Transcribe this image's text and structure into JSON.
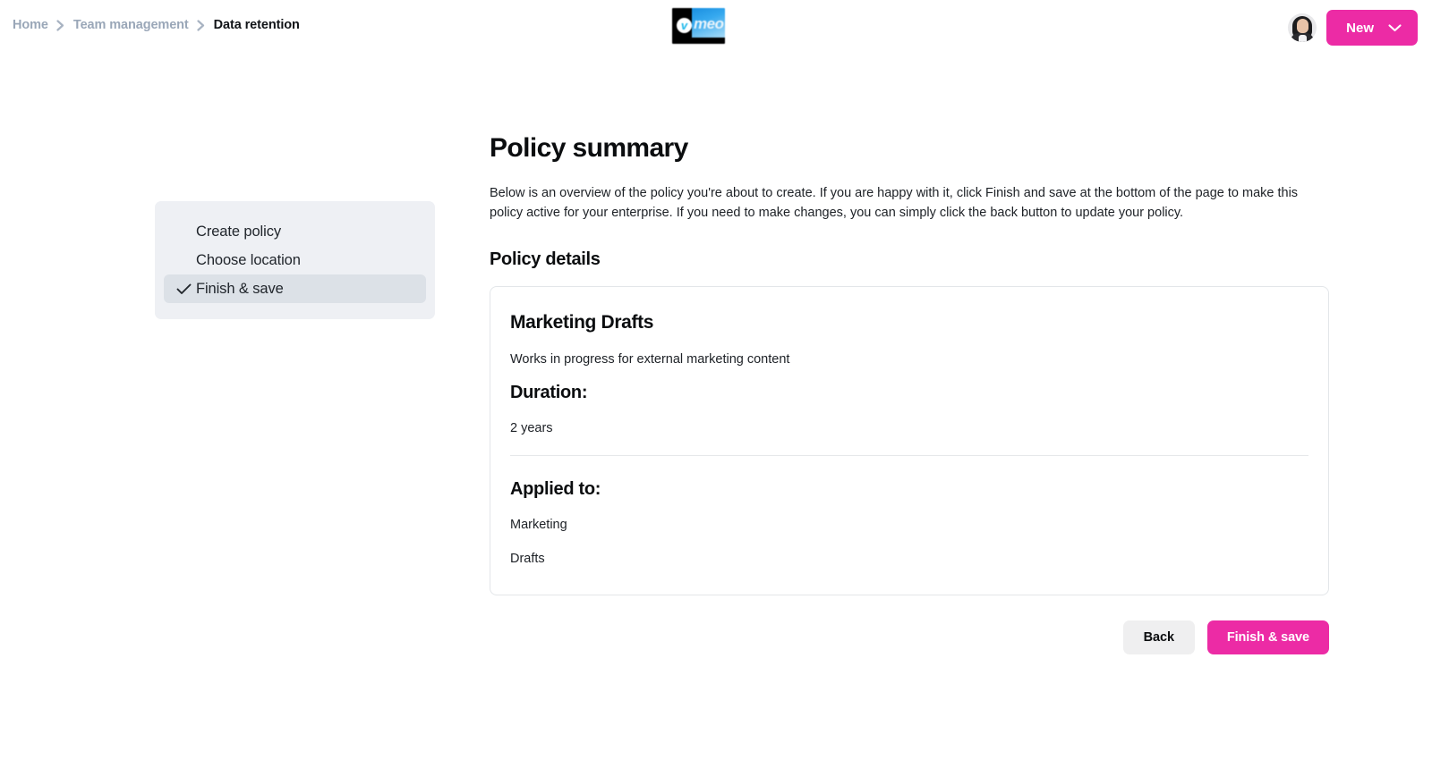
{
  "breadcrumb": {
    "items": [
      {
        "label": "Home",
        "current": false
      },
      {
        "label": "Team management",
        "current": false
      },
      {
        "label": "Data retention",
        "current": true
      }
    ],
    "separator_icon": "chevron-right-icon"
  },
  "topbar": {
    "logo": {
      "icon": "vimeo-logo",
      "mark": "v",
      "wordmark": "meo"
    },
    "avatar_icon": "user-avatar",
    "new_button": {
      "label": "New",
      "chevron_icon": "chevron-down-icon"
    },
    "accent_color": "#ec2ba5"
  },
  "stepper": {
    "items": [
      {
        "label": "Create policy",
        "active": false,
        "icon": ""
      },
      {
        "label": "Choose location",
        "active": false,
        "icon": ""
      },
      {
        "label": "Finish & save",
        "active": true,
        "icon": "check-icon"
      }
    ],
    "panel_color": "#eef0f4",
    "active_color": "#dce1e7"
  },
  "main": {
    "title": "Policy summary",
    "intro": "Below is an overview of the policy you're about to create. If you are happy with it, click Finish and save at the bottom of the page to make this policy active for your enterprise. If you need to make changes, you can simply click the back button to update your policy.",
    "section_title": "Policy details",
    "card": {
      "policy_name": "Marketing Drafts",
      "policy_description": "Works in progress for external marketing content",
      "duration_label": "Duration:",
      "duration_value": "2 years",
      "applied_to_label": "Applied to:",
      "applied_to": [
        "Marketing",
        "Drafts"
      ]
    }
  },
  "actions": {
    "back_label": "Back",
    "finish_label": "Finish & save"
  }
}
